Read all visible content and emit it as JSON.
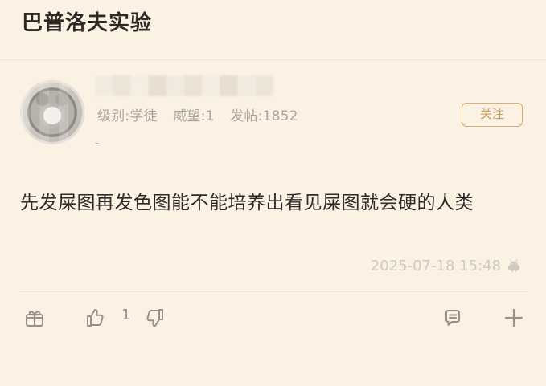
{
  "header": {
    "title": "巴普洛夫实验"
  },
  "author": {
    "meta": {
      "level": "级别:学徒",
      "reputation": "威望:1",
      "posts": "发帖:1852"
    },
    "follow_label": "关注"
  },
  "post": {
    "content": "先发屎图再发色图能不能培养出看见屎图就会硬的人类",
    "timestamp": "2025-07-18 15:48"
  },
  "actions": {
    "like_count": "1"
  },
  "icons": {
    "avatar": "avatar-icon",
    "android": "android-icon",
    "gift": "gift-icon",
    "like": "thumbs-up-icon",
    "dislike": "thumbs-down-icon",
    "comment": "comment-icon",
    "plus": "plus-icon"
  },
  "colors": {
    "background": "#fbf2e4",
    "accent": "#d9b06d",
    "text": "#2c2927",
    "meta": "#a8a49d",
    "icons": "#989089"
  }
}
